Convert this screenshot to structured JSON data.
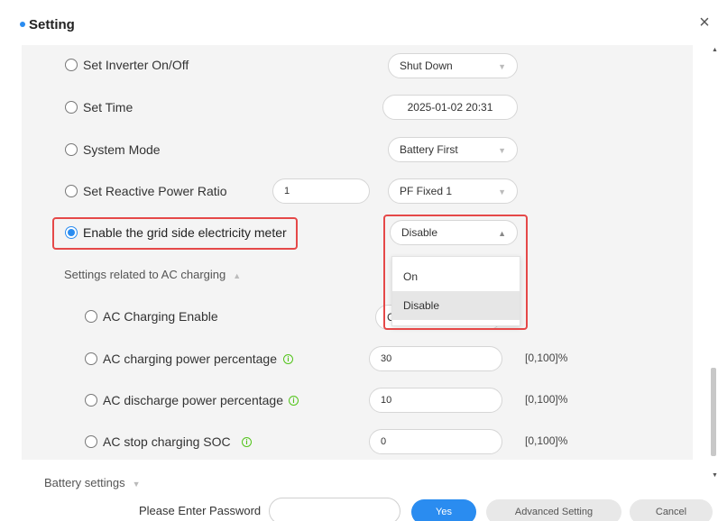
{
  "dialog": {
    "title": "Setting",
    "close_icon": "×"
  },
  "settings": [
    {
      "label": "Set Inverter On/Off",
      "control": "select",
      "value": "Shut Down"
    },
    {
      "label": "Set Time",
      "control": "field",
      "value": "2025-01-02 20:31"
    },
    {
      "label": "System Mode",
      "control": "select",
      "value": "Battery First"
    },
    {
      "label": "Set Reactive Power Ratio",
      "control": "field+select",
      "value": "1",
      "select_value": "PF Fixed 1"
    },
    {
      "label": "Enable the grid side electricity meter",
      "control": "select",
      "value": "Disable",
      "checked": true
    }
  ],
  "dropdown": {
    "options": [
      "On",
      "Disable"
    ],
    "selected": "Disable"
  },
  "ac_section": {
    "title": "Settings related to AC charging",
    "items": [
      {
        "label": "AC Charging Enable",
        "value": "C"
      },
      {
        "label": "AC charging power percentage",
        "value": "30",
        "range": "[0,100]%"
      },
      {
        "label": "AC discharge power percentage",
        "value": "10",
        "range": "[0,100]%"
      },
      {
        "label": "AC stop charging SOC",
        "value": "0",
        "range": "[0,100]%"
      }
    ]
  },
  "battery_section": {
    "title": "Battery settings"
  },
  "footer": {
    "password_label": "Please Enter Password",
    "yes": "Yes",
    "advanced": "Advanced Setting",
    "cancel": "Cancel"
  },
  "colors": {
    "accent": "#2a8cf0",
    "highlight": "#e54848",
    "info": "#52c41a"
  },
  "icons": {
    "info": "info-icon",
    "caret": "caret-down-icon",
    "caret_up": "caret-up-icon"
  }
}
